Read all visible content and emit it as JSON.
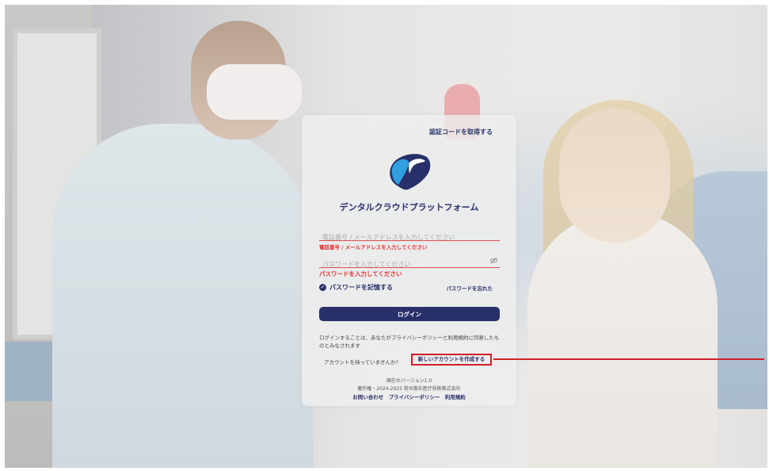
{
  "card": {
    "get_code_link": "認証コードを取得する",
    "title": "デンタルクラウドプラットフォーム",
    "phone_placeholder": "電話番号 / メールアドレスを入力してください",
    "phone_error": "電話番号 / メールアドレスを入力してください",
    "password_placeholder": "パスワードを入力してください",
    "password_error": "パスワードを入力してください",
    "remember_label": "パスワードを記憶する",
    "forgot_link": "パスワードを忘れた",
    "login_button": "ログイン",
    "policy_text": "ログインすることは、あなたがプライバシーポリシーと利用規約に同意したものとみなされます",
    "no_account_text": "アカウントを持っていませんか?",
    "create_account_link": "新しいアカウントを作成する",
    "version": "現在のバージョン1.0",
    "copyright": "著作権・2024-2025 常州惠乐医疗技術株式会社",
    "footer_links": [
      "お問い合わせ",
      "プライバシーポリシー",
      "利用規約"
    ]
  },
  "colors": {
    "brand": "#27306a",
    "error": "#e0312f",
    "highlight": "#d0202a",
    "logo_blue": "#2f9fe0"
  },
  "icons": {
    "logo": "tooth-logo-icon",
    "eye": "eye-off-icon",
    "checkbox": "check-circle-icon"
  },
  "state": {
    "remember_checked": true
  }
}
